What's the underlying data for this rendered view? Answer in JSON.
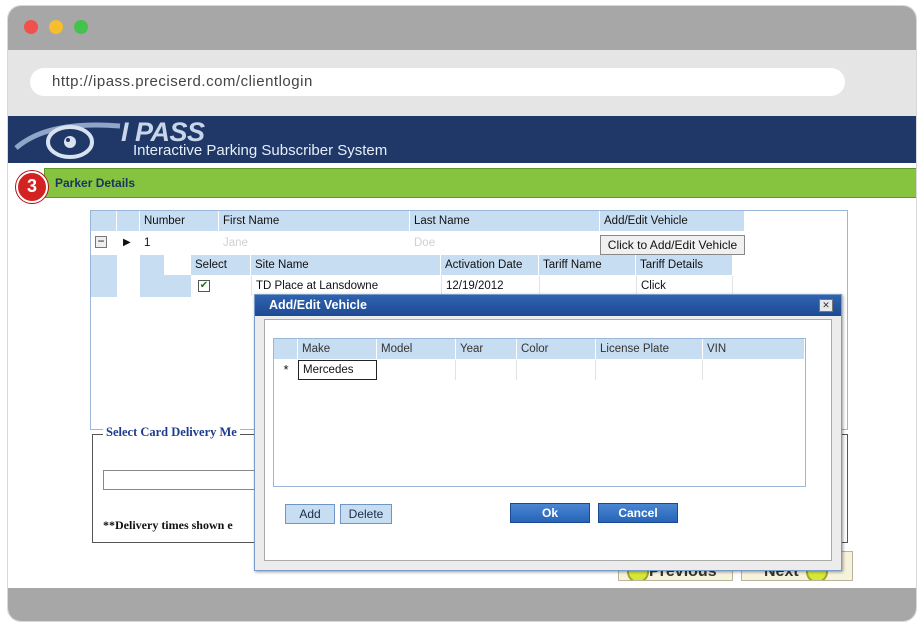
{
  "browser": {
    "url": "http://ipass.preciserd.com/clientlogin"
  },
  "banner": {
    "title": "I PASS",
    "subtitle": "Interactive Parking Subscriber System"
  },
  "section": {
    "step": "3",
    "title": "Parker Details"
  },
  "parker_grid": {
    "columns": [
      "Number",
      "First Name",
      "Last Name",
      "Add/Edit Vehicle"
    ],
    "row": {
      "number": "1",
      "first_name": "Jane",
      "last_name": "Doe",
      "action": "Click to Add/Edit Vehicle"
    },
    "sub_columns": [
      "Select",
      "Site Name",
      "Activation Date",
      "Tariff Name",
      "Tariff Details"
    ],
    "sub_row": {
      "site_name": "TD Place at Lansdowne",
      "activation_date": "12/19/2012",
      "tariff_name": "",
      "tariff_details": "Click"
    }
  },
  "delivery": {
    "legend": "Select Card Delivery Me",
    "note": "**Delivery times shown e"
  },
  "nav": {
    "previous": "Previous",
    "next": "Next"
  },
  "dialog": {
    "title": "Add/Edit Vehicle",
    "columns": [
      "Make",
      "Model",
      "Year",
      "Color",
      "License Plate",
      "VIN"
    ],
    "new_row_marker": "*",
    "make_value": "Mercedes",
    "buttons": {
      "add": "Add",
      "delete": "Delete",
      "ok": "Ok",
      "cancel": "Cancel"
    }
  }
}
